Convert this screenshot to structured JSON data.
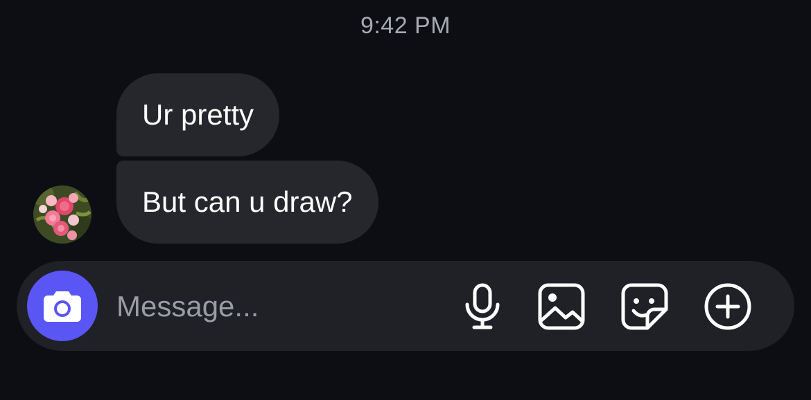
{
  "thread": {
    "timestamp": "9:42 PM",
    "messages": [
      {
        "text": "Ur pretty"
      },
      {
        "text": "But can u draw?"
      }
    ]
  },
  "composer": {
    "placeholder": "Message...",
    "camera_icon": "camera-icon",
    "tools": [
      {
        "icon": "microphone-icon"
      },
      {
        "icon": "gallery-icon"
      },
      {
        "icon": "sticker-icon"
      },
      {
        "icon": "plus-circle-icon"
      }
    ]
  },
  "colors": {
    "background": "#0c0e13",
    "bubble": "#25272d",
    "composer": "#1f2126",
    "accent": "#5a55f5",
    "timestamp": "#a7a9b0",
    "placeholder": "#9a9da6"
  }
}
